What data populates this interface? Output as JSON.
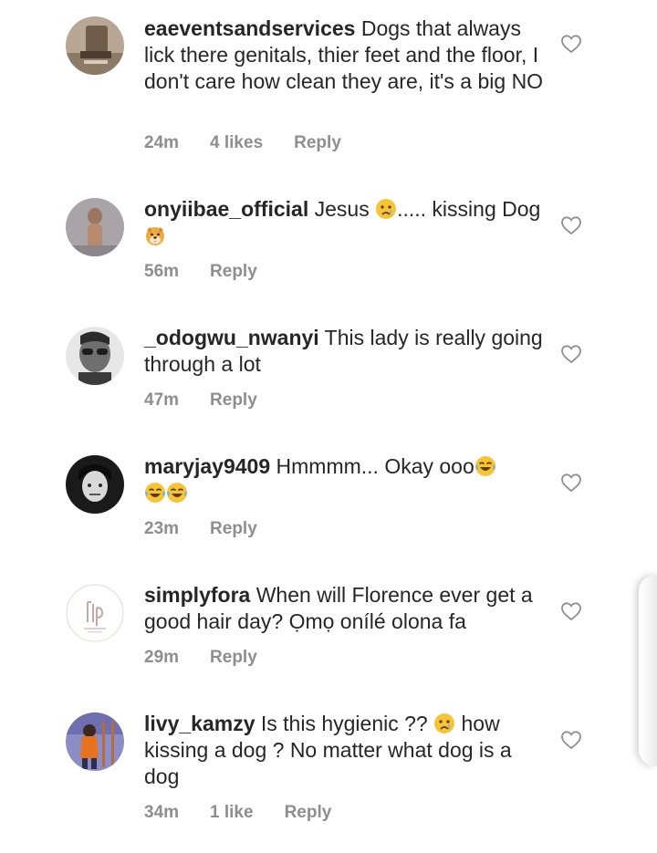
{
  "comments": [
    {
      "username": "eaeventsandservices",
      "text": " Dogs that always lick there genitals, thier feet and the floor, I don't care how clean they are, it's a big NO",
      "time": "24m",
      "likes": "4 likes",
      "reply": "Reply"
    },
    {
      "username": "onyiibae_official",
      "text_before": " Jesus ",
      "text_after": "..... kissing Dog ",
      "time": "56m",
      "reply": "Reply"
    },
    {
      "username": "_odogwu_nwanyi",
      "text": " This lady is really going through a lot",
      "time": "47m",
      "reply": "Reply"
    },
    {
      "username": "maryjay9409",
      "text": " Hmmmm... Okay ooo",
      "time": "23m",
      "reply": "Reply"
    },
    {
      "username": "simplyfora",
      "text": " When will Florence ever get a good hair day? Ọmọ onílé olona fa",
      "time": "29m",
      "reply": "Reply"
    },
    {
      "username": "livy_kamzy",
      "text_before": " Is this hygienic ?? ",
      "text_after": " how kissing a dog ? No matter what dog is a dog",
      "time": "34m",
      "likes": "1 like",
      "reply": "Reply"
    }
  ],
  "icons": {
    "like": "heart-outline-icon",
    "crying": "crying-face-emoji",
    "dog": "dog-face-emoji",
    "laughing": "tears-of-joy-emoji"
  },
  "colors": {
    "text": "#262626",
    "meta": "#8e8e8e",
    "background": "#ffffff"
  }
}
